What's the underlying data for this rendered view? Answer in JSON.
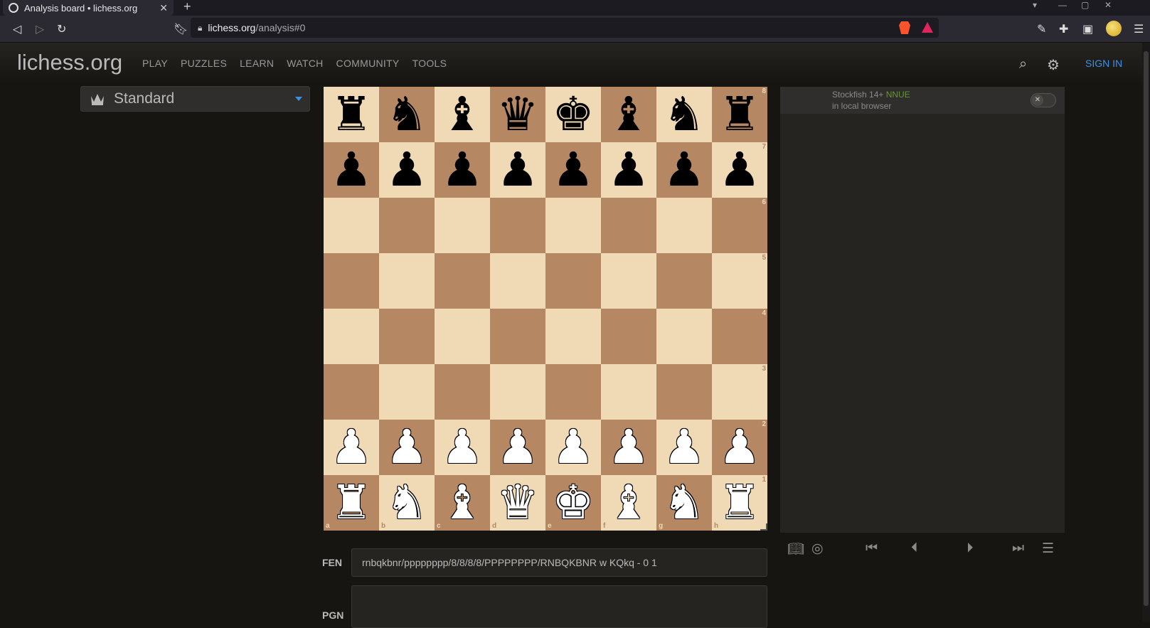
{
  "browser": {
    "tab_title": "Analysis board • lichess.org",
    "tab_close": "✕",
    "new_tab": "+",
    "url_host": "lichess.org",
    "url_path": "/analysis#0"
  },
  "header": {
    "logo": "lichess.org",
    "nav": [
      "PLAY",
      "PUZZLES",
      "LEARN",
      "WATCH",
      "COMMUNITY",
      "TOOLS"
    ],
    "sign_in": "SIGN IN"
  },
  "variant": {
    "label": "Standard"
  },
  "board": {
    "ranks": [
      "8",
      "7",
      "6",
      "5",
      "4",
      "3",
      "2",
      "1"
    ],
    "files": [
      "a",
      "b",
      "c",
      "d",
      "e",
      "f",
      "g",
      "h"
    ],
    "rows": [
      [
        "♜",
        "♞",
        "♝",
        "♛",
        "♚",
        "♝",
        "♞",
        "♜"
      ],
      [
        "♟",
        "♟",
        "♟",
        "♟",
        "♟",
        "♟",
        "♟",
        "♟"
      ],
      [
        "",
        "",
        "",
        "",
        "",
        "",
        "",
        ""
      ],
      [
        "",
        "",
        "",
        "",
        "",
        "",
        "",
        ""
      ],
      [
        "",
        "",
        "",
        "",
        "",
        "",
        "",
        ""
      ],
      [
        "",
        "",
        "",
        "",
        "",
        "",
        "",
        ""
      ],
      [
        "♟",
        "♟",
        "♟",
        "♟",
        "♟",
        "♟",
        "♟",
        "♟"
      ],
      [
        "♜",
        "♞",
        "♝",
        "♛",
        "♚",
        "♝",
        "♞",
        "♜"
      ]
    ],
    "colors": [
      "b",
      "b",
      "",
      "",
      "",
      "",
      "w",
      "w"
    ]
  },
  "engine": {
    "name": "Stockfish 14+",
    "tag": "NNUE",
    "location": "in local browser",
    "toggle_on": false
  },
  "fen": {
    "label": "FEN",
    "value": "rnbqkbnr/pppppppp/8/8/8/8/PPPPPPPP/RNBQKBNR w KQkq - 0 1"
  },
  "pgn": {
    "label": "PGN"
  }
}
